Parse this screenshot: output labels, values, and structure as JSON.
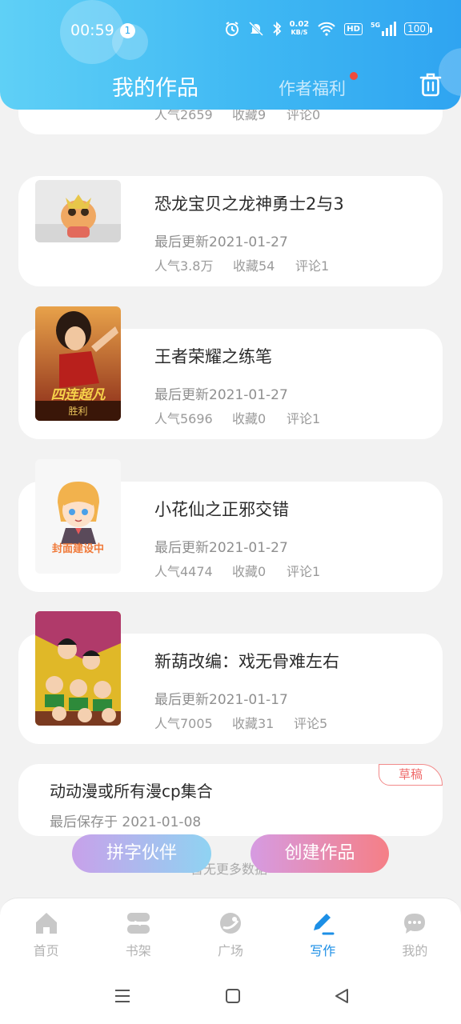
{
  "status_bar": {
    "time": "00:59",
    "notification_count": "1",
    "net_speed_value": "0.02",
    "net_speed_unit": "KB/S",
    "hd_label": "HD",
    "signal_label": "5G",
    "battery": "100"
  },
  "header": {
    "tab_active": "我的作品",
    "tab_inactive": "作者福利",
    "colors": {
      "start": "#5fd0f6",
      "end": "#2fa4f1"
    }
  },
  "works": [
    {
      "title": "",
      "updated": "",
      "popularity": "人气2659",
      "favorites": "收藏9",
      "comments": "评论0"
    },
    {
      "title": "恐龙宝贝之龙神勇士2与3",
      "updated": "最后更新2021-01-27",
      "popularity": "人气3.8万",
      "favorites": "收藏54",
      "comments": "评论1"
    },
    {
      "title": "王者荣耀之练笔",
      "updated": "最后更新2021-01-27",
      "popularity": "人气5696",
      "favorites": "收藏0",
      "comments": "评论1",
      "cover_text_top": "四连超凡",
      "cover_text_bottom": "胜利"
    },
    {
      "title": "小花仙之正邪交错",
      "updated": "最后更新2021-01-27",
      "popularity": "人气4474",
      "favorites": "收藏0",
      "comments": "评论1",
      "cover_text": "封面建设中"
    },
    {
      "title": "新葫改编：戏无骨难左右",
      "updated": "最后更新2021-01-17",
      "popularity": "人气7005",
      "favorites": "收藏31",
      "comments": "评论5"
    }
  ],
  "draft": {
    "title": "动动漫或所有漫cp集合",
    "saved": "最后保存于 2021-01-08",
    "tag": "草稿"
  },
  "buttons": {
    "partner": "拼字伙伴",
    "create": "创建作品"
  },
  "list_end_text": "暂无更多数据",
  "bottom_nav": [
    {
      "label": "首页",
      "icon": "home-icon"
    },
    {
      "label": "书架",
      "icon": "bookshelf-icon"
    },
    {
      "label": "广场",
      "icon": "planet-icon"
    },
    {
      "label": "写作",
      "icon": "pen-icon",
      "active": true
    },
    {
      "label": "我的",
      "icon": "chat-icon"
    }
  ],
  "colors": {
    "accent": "#1c8fe6",
    "draft_tag": "#ef6b6b",
    "badge_red": "#f04b3c"
  }
}
